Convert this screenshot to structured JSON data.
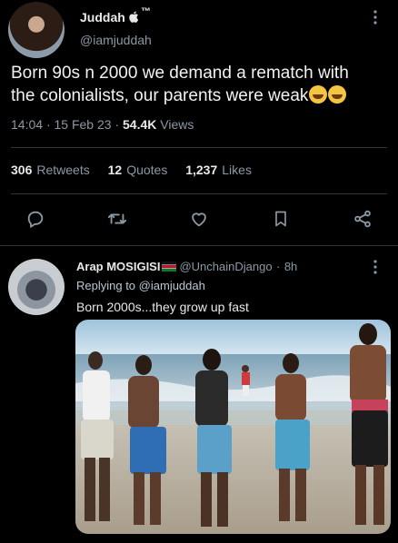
{
  "tweet": {
    "author_name": "Juddah",
    "author_badge": "™",
    "handle": "@iamjuddah",
    "text_line1": "Born 90s n 2000 we demand a rematch with",
    "text_line2": "the colonialists, our parents were weak",
    "time": "14:04",
    "date": "15 Feb 23",
    "views_count": "54.4K",
    "views_label": "Views",
    "more_icon": "more-vertical-icon"
  },
  "stats": {
    "retweets_count": "306",
    "retweets_label": "Retweets",
    "quotes_count": "12",
    "quotes_label": "Quotes",
    "likes_count": "1,237",
    "likes_label": "Likes"
  },
  "actions": {
    "icons": [
      "reply-icon",
      "retweet-icon",
      "like-icon",
      "bookmark-icon",
      "share-icon"
    ]
  },
  "reply": {
    "author_name": "Arap MOSIGISI",
    "handle": "@UnchainDjango",
    "separator": "·",
    "time": "8h",
    "replying_prefix": "Replying to",
    "replying_to": "@iamjuddah",
    "text": "Born 2000s...they grow up fast"
  },
  "colors": {
    "background": "#000000",
    "text": "#e7e9ea",
    "muted": "#8b98a5",
    "divider": "#2f3336"
  }
}
